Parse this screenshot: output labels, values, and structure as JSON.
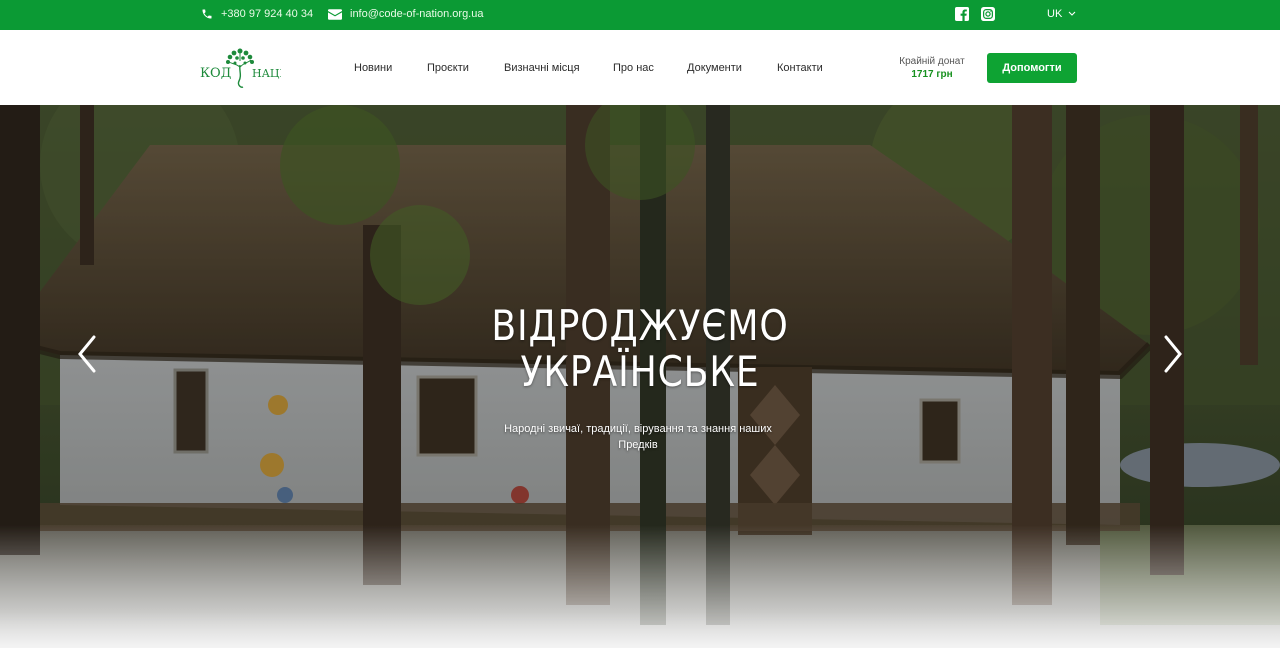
{
  "topbar": {
    "phone": "+380 97 924 40 34",
    "email": "info@code-of-nation.org.ua",
    "language": "UK",
    "icons": {
      "phone": "phone-icon",
      "email": "mail-icon",
      "facebook": "facebook-icon",
      "instagram": "instagram-icon",
      "dropdown": "chevron-down-icon"
    }
  },
  "header": {
    "logo_text_left": "КОД",
    "logo_text_right": "НАЦІЇ",
    "nav": [
      {
        "label": "Новини"
      },
      {
        "label": "Проєкти"
      },
      {
        "label": "Визначні місця"
      },
      {
        "label": "Про нас"
      },
      {
        "label": "Документи"
      },
      {
        "label": "Контакти"
      }
    ],
    "donate_label": "Крайній донат",
    "donate_value": "1717 грн",
    "help_button": "Допомогти"
  },
  "hero": {
    "title_line1": "ВІДРОДЖУЄМО",
    "title_line2": "УКРАЇНСЬКЕ",
    "subtitle": "Народні звичаї, традиції, вірування та знання наших Предків",
    "icons": {
      "prev": "chevron-left-icon",
      "next": "chevron-right-icon"
    }
  },
  "colors": {
    "brand_green": "#0b9a34",
    "button_green": "#0ea333",
    "donate_green": "#17911f"
  }
}
